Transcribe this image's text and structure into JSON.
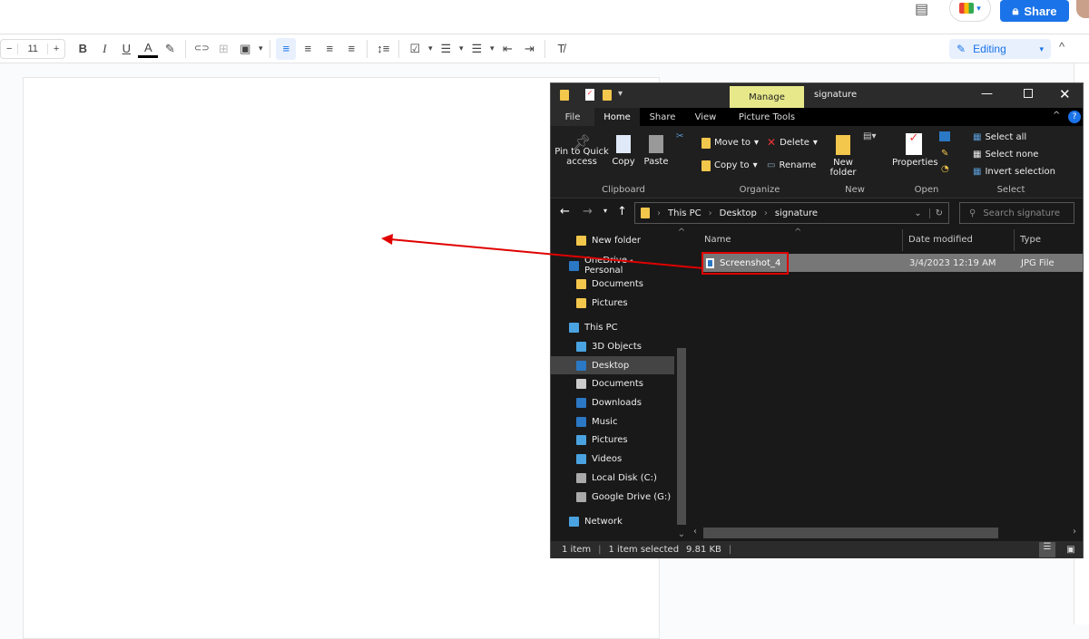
{
  "docs": {
    "share_label": "Share",
    "font_size": "11",
    "mode": "Editing",
    "toolbar_icons": [
      "decrease-font",
      "increase-font",
      "bold",
      "italic",
      "underline",
      "text-color",
      "highlight",
      "link",
      "comment",
      "image",
      "align-left",
      "align-center",
      "align-right",
      "justify",
      "line-spacing",
      "checklist",
      "bulleted-list",
      "numbered-list",
      "decrease-indent",
      "increase-indent",
      "clear-formatting"
    ],
    "toolbar_glyphs": {
      "minus": "−",
      "plus": "+",
      "bold": "B",
      "italic": "I",
      "underline": "U",
      "text_color": "A",
      "highlight": "✎",
      "link": "⊂⊃",
      "comment": "⊞",
      "image": "▣",
      "align_left": "≡",
      "align_center": "≡",
      "align_right": "≡",
      "justify": "≡",
      "line_spacing": "↕≡",
      "checklist": "☑",
      "bullets": "☰",
      "numbers": "☰",
      "outdent": "⇤",
      "indent": "⇥",
      "clear": "T̸",
      "caret": "▾",
      "collapse": "^"
    },
    "accent_color": "#1a73e8"
  },
  "explorer": {
    "title": "signature",
    "manage_tab": "Manage",
    "tabs": [
      "File",
      "Home",
      "Share",
      "View",
      "Picture Tools"
    ],
    "ribbon": {
      "clipboard": {
        "label": "Clipboard",
        "pin": "Pin to Quick access",
        "copy": "Copy",
        "paste": "Paste"
      },
      "organize": {
        "label": "Organize",
        "move_to": "Move to",
        "copy_to": "Copy to",
        "delete": "Delete",
        "rename": "Rename"
      },
      "new": {
        "label": "New",
        "new_folder": "New folder"
      },
      "open": {
        "label": "Open",
        "properties": "Properties"
      },
      "select": {
        "label": "Select",
        "select_all": "Select all",
        "select_none": "Select none",
        "invert": "Invert selection"
      }
    },
    "path": [
      "This PC",
      "Desktop",
      "signature"
    ],
    "search_placeholder": "Search signature",
    "nav_items": [
      {
        "label": "New folder",
        "icon": "folder-icon"
      },
      {
        "label": "OneDrive - Personal",
        "icon": "cloud-icon"
      },
      {
        "label": "Documents",
        "icon": "folder-icon"
      },
      {
        "label": "Pictures",
        "icon": "folder-icon"
      },
      {
        "label": "This PC",
        "icon": "computer-icon"
      },
      {
        "label": "3D Objects",
        "icon": "cube-icon"
      },
      {
        "label": "Desktop",
        "icon": "desktop-icon",
        "selected": true
      },
      {
        "label": "Documents",
        "icon": "document-icon"
      },
      {
        "label": "Downloads",
        "icon": "download-icon"
      },
      {
        "label": "Music",
        "icon": "music-icon"
      },
      {
        "label": "Pictures",
        "icon": "picture-icon"
      },
      {
        "label": "Videos",
        "icon": "video-icon"
      },
      {
        "label": "Local Disk (C:)",
        "icon": "disk-icon"
      },
      {
        "label": "Google Drive (G:)",
        "icon": "drive-icon"
      },
      {
        "label": "Network",
        "icon": "network-icon"
      }
    ],
    "columns": [
      "Name",
      "Date modified",
      "Type"
    ],
    "files": [
      {
        "name": "Screenshot_4",
        "date": "3/4/2023 12:19 AM",
        "type": "JPG File"
      }
    ],
    "status": {
      "count": "1 item",
      "selected": "1 item selected",
      "size": "9.81 KB"
    },
    "annotation_color": "#e00000"
  }
}
